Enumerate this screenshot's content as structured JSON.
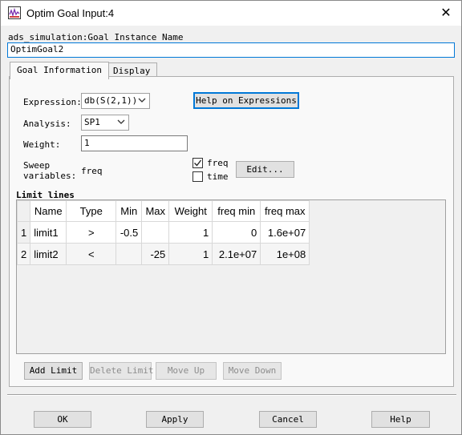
{
  "window": {
    "title": "Optim Goal Input:4",
    "close_glyph": "✕"
  },
  "goal_instance": {
    "label": "ads_simulation:Goal Instance Name",
    "value": "OptimGoal2"
  },
  "tabs": [
    {
      "label": "Goal Information",
      "active": true
    },
    {
      "label": "Display",
      "active": false
    }
  ],
  "form": {
    "expression_label": "Expression:",
    "expression_value": "db(S(2,1))",
    "help_button": "Help on Expressions",
    "analysis_label": "Analysis:",
    "analysis_value": "SP1",
    "weight_label": "Weight:",
    "weight_value": "1",
    "sweep_label_line1": "Sweep",
    "sweep_label_line2": "variables:",
    "sweep_value": "freq",
    "check_freq_label": "freq",
    "check_freq_checked": true,
    "check_time_label": "time",
    "check_time_checked": false,
    "edit_button": "Edit..."
  },
  "limit_lines": {
    "label": "Limit lines",
    "columns": [
      "Name",
      "Type",
      "Min",
      "Max",
      "Weight",
      "freq min",
      "freq max"
    ],
    "rows": [
      {
        "index": "1",
        "name": "limit1",
        "type": ">",
        "min": "-0.5",
        "max": "",
        "weight": "1",
        "freq_min": "0",
        "freq_max": "1.6e+07"
      },
      {
        "index": "2",
        "name": "limit2",
        "type": "<",
        "min": "",
        "max": "-25",
        "weight": "1",
        "freq_min": "2.1e+07",
        "freq_max": "1e+08"
      }
    ],
    "buttons": {
      "add": "Add Limit",
      "delete": "Delete Limit",
      "move_up": "Move Up",
      "move_down": "Move Down"
    }
  },
  "footer": {
    "ok": "OK",
    "apply": "Apply",
    "cancel": "Cancel",
    "help": "Help"
  },
  "colors": {
    "focus_accent": "#0078d7",
    "disabled_text": "#8d8d8d"
  }
}
